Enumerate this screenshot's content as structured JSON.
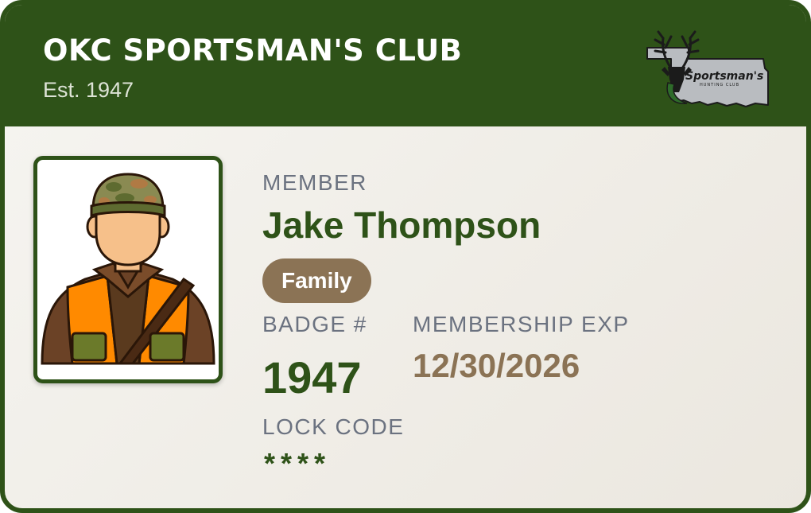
{
  "header": {
    "club_name": "OKC SPORTSMAN'S CLUB",
    "established": "Est. 1947",
    "logo": {
      "icon": "deer-head-oklahoma-logo",
      "text_main": "Sportsman's",
      "text_sub": "HUNTING CLUB"
    }
  },
  "member": {
    "photo_icon": "hunter-avatar-icon",
    "label": "MEMBER",
    "name": "Jake Thompson",
    "tier": "Family"
  },
  "badge": {
    "label": "BADGE #",
    "number": "1947"
  },
  "membership": {
    "label": "MEMBERSHIP EXP",
    "expires": "12/30/2026"
  },
  "lock": {
    "label": "LOCK CODE",
    "code": "****"
  },
  "colors": {
    "primary_green": "#2e5218",
    "accent_brown": "#8b7355",
    "label_gray": "#6b7280",
    "hunter_orange": "#ff8a00"
  }
}
